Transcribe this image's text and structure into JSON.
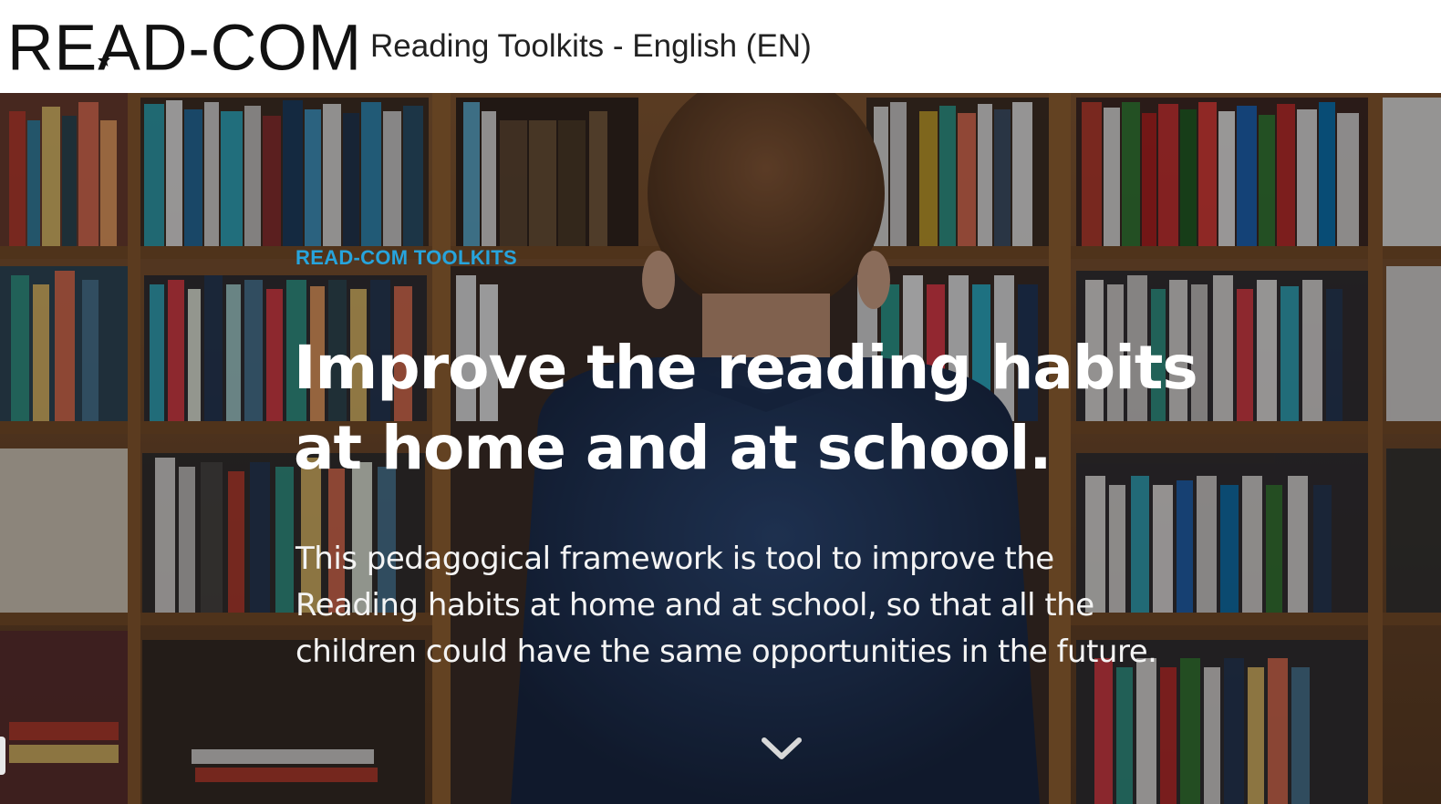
{
  "header": {
    "logo_text": "READ-COM",
    "site_title": "Reading Toolkits - English (EN)"
  },
  "hero": {
    "kicker": "READ-COM TOOLKITS",
    "headline_line1": "Improve the reading habits",
    "headline_line2": "at home and at school.",
    "subtext_line1": "This pedagogical framework is tool to improve the",
    "subtext_line2": "Reading habits at home and at school, so that all the",
    "subtext_line3": "children could have the same opportunities in the future.",
    "scroll_icon": "chevron-down-icon",
    "background": "photo-child-facing-bookshelves"
  },
  "colors": {
    "accent": "#27a4dc",
    "headline": "#ffffff",
    "header_bg": "#ffffff"
  }
}
